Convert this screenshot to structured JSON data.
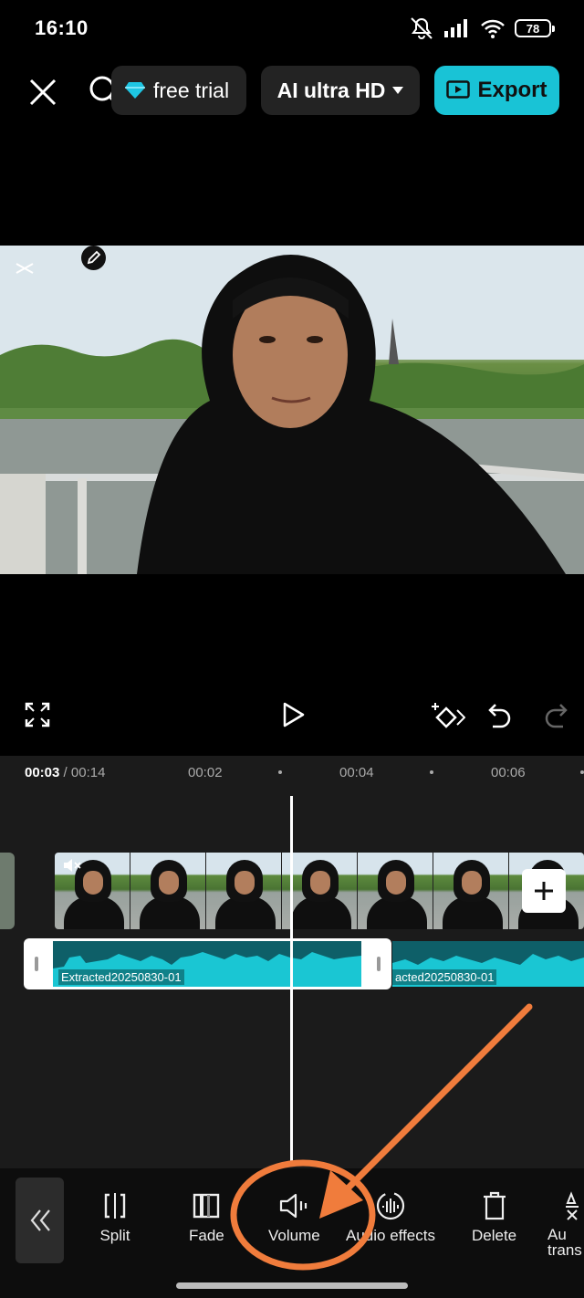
{
  "status_bar": {
    "time": "16:10",
    "battery": "78",
    "icons": [
      "mute-icon",
      "signal-icon",
      "wifi-icon",
      "battery-icon"
    ]
  },
  "top_bar": {
    "close_icon": "close-icon",
    "search_icon": "search-icon",
    "free_trial_label": "free trial",
    "resolution_label": "AI ultra HD",
    "export_label": "Export"
  },
  "timeline": {
    "current_time": "00:03",
    "separator": "/",
    "total_time": "00:14",
    "ticks": [
      "00:02",
      "00:04",
      "00:06"
    ],
    "audio_clip_label": "Extracted20250830-01",
    "audio_clip2_label": "acted20250830-01"
  },
  "toolbar": {
    "items": [
      {
        "label": "Split"
      },
      {
        "label": "Fade"
      },
      {
        "label": "Volume"
      },
      {
        "label": "Audio effects"
      },
      {
        "label": "Delete"
      },
      {
        "label": "Au",
        "label2": "trans"
      }
    ]
  },
  "colors": {
    "accent": "#19c3d6",
    "annotation": "#f07c3c",
    "waveform": "#1ac6d3"
  }
}
